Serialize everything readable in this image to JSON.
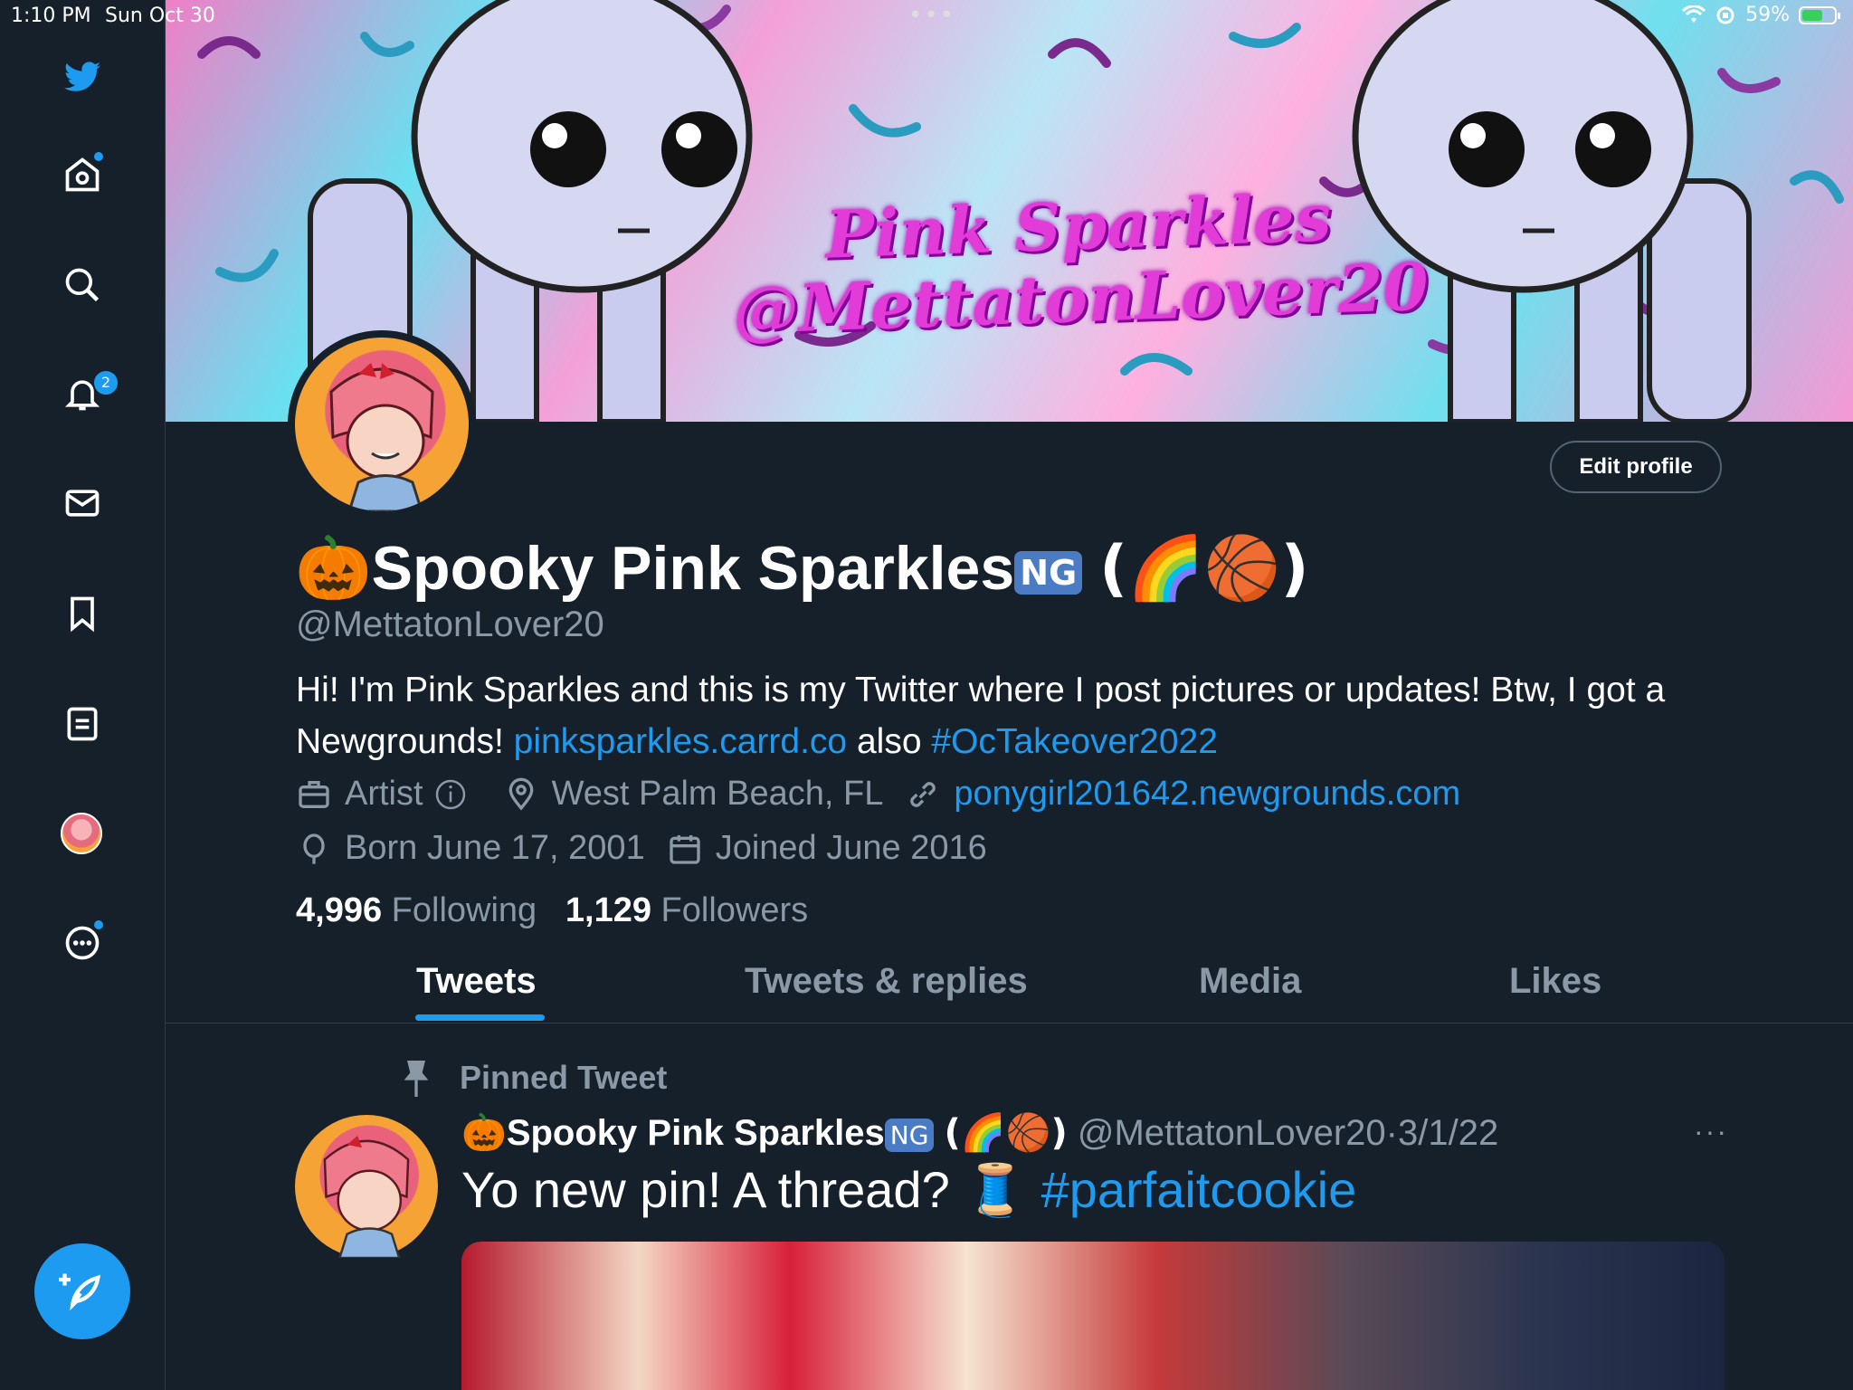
{
  "status_bar": {
    "time": "1:10 PM",
    "date": "Sun Oct 30",
    "battery": "59%",
    "battery_level": 0.59
  },
  "sidebar": {
    "items": [
      {
        "icon": "twitter-bird-icon"
      },
      {
        "icon": "home-icon"
      },
      {
        "icon": "search-icon"
      },
      {
        "icon": "bell-icon",
        "badge": "2"
      },
      {
        "icon": "mail-icon"
      },
      {
        "icon": "bookmark-icon"
      },
      {
        "icon": "lists-icon"
      },
      {
        "icon": "profile-avatar-icon"
      },
      {
        "icon": "more-icon"
      }
    ],
    "compose_icon": "compose-icon"
  },
  "banner": {
    "line1": "Pink Sparkles",
    "line2": "@MettatonLover20"
  },
  "profile": {
    "edit_label": "Edit profile",
    "name_prefix": "🎃",
    "name": "Spooky Pink Sparkles",
    "name_badge": "NG",
    "name_suffix": "(🌈🏀)",
    "handle": "@MettatonLover20",
    "bio_text": "Hi! I'm Pink Sparkles and this is my Twitter where I post pictures or updates! Btw, I got a Newgrounds!",
    "bio_link": "pinksparkles.carrd.co",
    "bio_also": "also",
    "bio_hashtag": "#OcTakeover2022",
    "category": "Artist",
    "location": "West Palm Beach, FL",
    "website": "ponygirl201642.newgrounds.com",
    "born": "Born June 17, 2001",
    "joined": "Joined June 2016",
    "following_count": "4,996",
    "following_label": "Following",
    "followers_count": "1,129",
    "followers_label": "Followers"
  },
  "tabs": [
    "Tweets",
    "Tweets & replies",
    "Media",
    "Likes"
  ],
  "pinned": {
    "label": "Pinned Tweet",
    "name_prefix": "🎃",
    "name": "Spooky Pink Sparkles",
    "name_badge": "NG",
    "name_suffix": "(🌈🏀)",
    "handle": "@MettatonLover20",
    "separator": "·",
    "date": "3/1/22",
    "more": "···",
    "text": "Yo new pin! A thread? 🧵",
    "hashtag": "#parfaitcookie"
  },
  "colors": {
    "background": "#15202b",
    "accent": "#1d9bf0",
    "secondary_text": "#8b98a5"
  }
}
